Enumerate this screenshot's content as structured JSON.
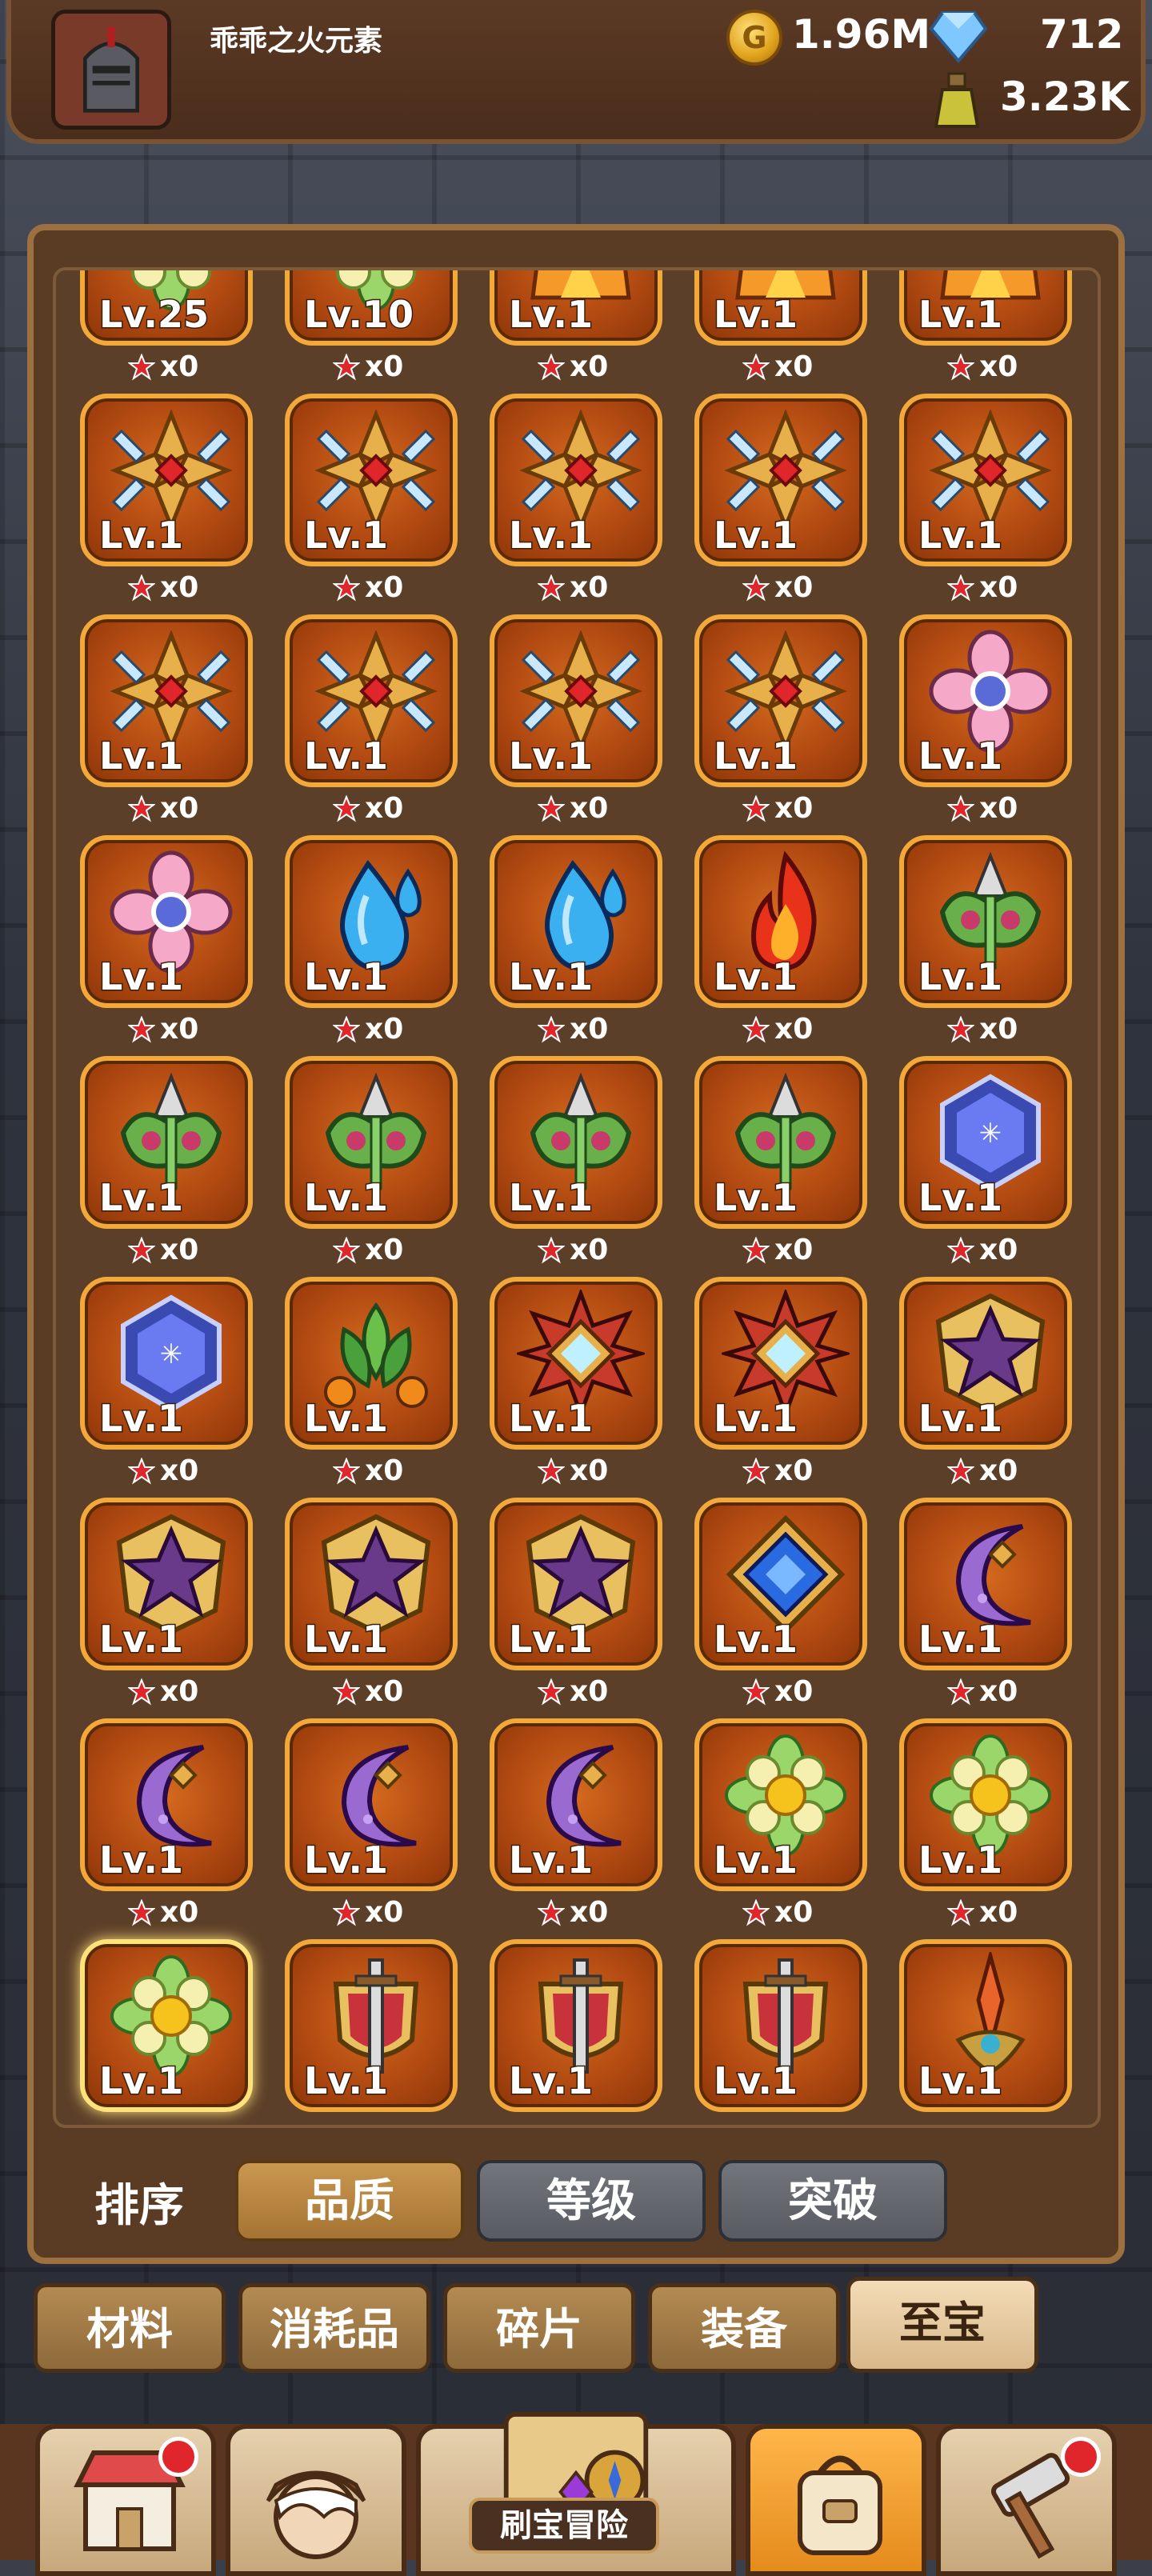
{
  "player": {
    "name": "乖乖之火元素"
  },
  "resources": {
    "gold": "1.96M",
    "gems": "712",
    "potion": "3.23K"
  },
  "inventory": {
    "rows": [
      {
        "items": [
          {
            "icon": "flower-yellow",
            "level": "Lv.25",
            "count": "x0"
          },
          {
            "icon": "flower-yellow",
            "level": "Lv.10",
            "count": "x0"
          },
          {
            "icon": "flame-crown",
            "level": "Lv.1",
            "count": "x0"
          },
          {
            "icon": "flame-crown",
            "level": "Lv.1",
            "count": "x0"
          },
          {
            "icon": "flame-crown",
            "level": "Lv.1",
            "count": "x0"
          }
        ]
      },
      {
        "items": [
          {
            "icon": "gold-cross",
            "level": "Lv.1",
            "count": "x0"
          },
          {
            "icon": "gold-cross",
            "level": "Lv.1",
            "count": "x0"
          },
          {
            "icon": "gold-cross",
            "level": "Lv.1",
            "count": "x0"
          },
          {
            "icon": "gold-cross",
            "level": "Lv.1",
            "count": "x0"
          },
          {
            "icon": "gold-cross",
            "level": "Lv.1",
            "count": "x0"
          }
        ]
      },
      {
        "items": [
          {
            "icon": "gold-cross",
            "level": "Lv.1",
            "count": "x0"
          },
          {
            "icon": "gold-cross",
            "level": "Lv.1",
            "count": "x0"
          },
          {
            "icon": "gold-cross",
            "level": "Lv.1",
            "count": "x0"
          },
          {
            "icon": "gold-cross",
            "level": "Lv.1",
            "count": "x0"
          },
          {
            "icon": "pink-flower",
            "level": "Lv.1",
            "count": "x0"
          }
        ]
      },
      {
        "items": [
          {
            "icon": "pink-flower",
            "level": "Lv.1",
            "count": "x0"
          },
          {
            "icon": "water-drop",
            "level": "Lv.1",
            "count": "x0"
          },
          {
            "icon": "water-drop",
            "level": "Lv.1",
            "count": "x0"
          },
          {
            "icon": "fire-flame",
            "level": "Lv.1",
            "count": "x0"
          },
          {
            "icon": "green-thorn",
            "level": "Lv.1",
            "count": "x0"
          }
        ]
      },
      {
        "items": [
          {
            "icon": "green-thorn",
            "level": "Lv.1",
            "count": "x0"
          },
          {
            "icon": "green-thorn",
            "level": "Lv.1",
            "count": "x0"
          },
          {
            "icon": "green-thorn",
            "level": "Lv.1",
            "count": "x0"
          },
          {
            "icon": "green-thorn",
            "level": "Lv.1",
            "count": "x0"
          },
          {
            "icon": "blue-hexagon",
            "level": "Lv.1",
            "count": "x0"
          }
        ]
      },
      {
        "items": [
          {
            "icon": "blue-hexagon",
            "level": "Lv.1",
            "count": "x0"
          },
          {
            "icon": "green-leaf",
            "level": "Lv.1",
            "count": "x0"
          },
          {
            "icon": "diamond-star",
            "level": "Lv.1",
            "count": "x0"
          },
          {
            "icon": "diamond-star",
            "level": "Lv.1",
            "count": "x0"
          },
          {
            "icon": "purple-star-shield",
            "level": "Lv.1",
            "count": "x0"
          }
        ]
      },
      {
        "items": [
          {
            "icon": "purple-star-shield",
            "level": "Lv.1",
            "count": "x0"
          },
          {
            "icon": "purple-star-shield",
            "level": "Lv.1",
            "count": "x0"
          },
          {
            "icon": "purple-star-shield",
            "level": "Lv.1",
            "count": "x0"
          },
          {
            "icon": "blue-rune",
            "level": "Lv.1",
            "count": "x0"
          },
          {
            "icon": "purple-moon",
            "level": "Lv.1",
            "count": "x0"
          }
        ]
      },
      {
        "items": [
          {
            "icon": "purple-moon",
            "level": "Lv.1",
            "count": "x0"
          },
          {
            "icon": "purple-moon",
            "level": "Lv.1",
            "count": "x0"
          },
          {
            "icon": "purple-moon",
            "level": "Lv.1",
            "count": "x0"
          },
          {
            "icon": "flower-yellow",
            "level": "Lv.1",
            "count": "x0"
          },
          {
            "icon": "flower-yellow",
            "level": "Lv.1",
            "count": "x0"
          }
        ]
      },
      {
        "items": [
          {
            "icon": "flower-yellow",
            "level": "Lv.1",
            "count": "",
            "selected": true
          },
          {
            "icon": "sword-shield",
            "level": "Lv.1",
            "count": ""
          },
          {
            "icon": "sword-shield",
            "level": "Lv.1",
            "count": ""
          },
          {
            "icon": "sword-shield",
            "level": "Lv.1",
            "count": ""
          },
          {
            "icon": "flame-blade",
            "level": "Lv.1",
            "count": ""
          }
        ]
      }
    ]
  },
  "sort": {
    "label": "排序",
    "buttons": [
      {
        "label": "品质",
        "active": true
      },
      {
        "label": "等级",
        "active": false
      },
      {
        "label": "突破",
        "active": false
      }
    ]
  },
  "categories": [
    {
      "label": "材料",
      "active": false
    },
    {
      "label": "消耗品",
      "active": false
    },
    {
      "label": "碎片",
      "active": false
    },
    {
      "label": "装备",
      "active": false
    },
    {
      "label": "至宝",
      "active": true
    }
  ],
  "bottom_nav": {
    "adventure_label": "刷宝冒险",
    "items": [
      {
        "icon": "shop-icon",
        "badge": true
      },
      {
        "icon": "hero-icon",
        "badge": false
      },
      {
        "icon": "map-icon",
        "badge": false
      },
      {
        "icon": "bag-icon",
        "badge": false,
        "active": true
      },
      {
        "icon": "forge-icon",
        "badge": true
      }
    ]
  },
  "colors": {
    "tile_border": "#f3a93a",
    "tile_bg": "#b24a12",
    "active_sort": "#a57433",
    "badge": "#e0262a"
  }
}
